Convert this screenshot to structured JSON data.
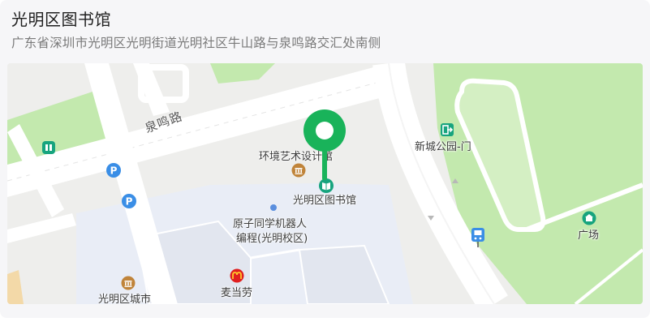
{
  "place": {
    "name": "光明区图书馆",
    "address": "广东省深圳市光明区光明街道光明社区牛山路与泉鸣路交汇处南侧"
  },
  "map": {
    "road_labels": [
      "泉鸣路"
    ],
    "pois": {
      "art_hall": "环境艺术设计馆",
      "library": "光明区图书馆",
      "park_gate": "新城公园-门",
      "atom_school_line1": "原子同学机器人",
      "atom_school_line2": "编程(光明校区)",
      "square": "广场",
      "city_hall": "光明区城市",
      "mcdonalds": "麦当劳"
    },
    "icons": [
      "pin-marker",
      "parking",
      "museum",
      "library",
      "park-exit",
      "bus-stop",
      "square",
      "mcdonalds",
      "toilet"
    ],
    "colors": {
      "pin": "#19b35a",
      "green_area": "#c3e9ae",
      "parking_blue": "#3a8ee6",
      "poi_teal": "#17a47e",
      "museum_brown": "#c0843a",
      "mcd_red": "#e02020",
      "mcd_yellow": "#ffc72c"
    }
  }
}
